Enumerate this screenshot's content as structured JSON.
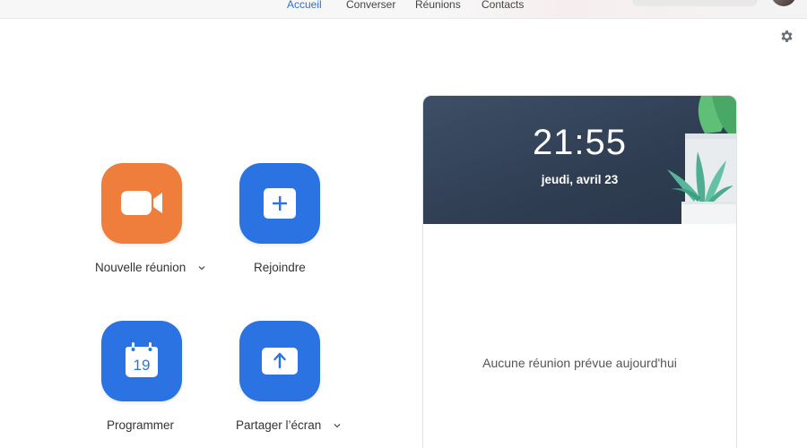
{
  "nav": {
    "tabs": [
      {
        "label": "Accueil",
        "active": true
      },
      {
        "label": "Converser",
        "active": false
      },
      {
        "label": "Réunions",
        "active": false
      },
      {
        "label": "Contacts",
        "active": false
      }
    ]
  },
  "actions": {
    "new_meeting": {
      "label": "Nouvelle réunion",
      "icon": "video-camera-icon",
      "color": "#ef7d3b"
    },
    "join": {
      "label": "Rejoindre",
      "icon": "plus-icon",
      "color": "#2b73e2"
    },
    "schedule": {
      "label": "Programmer",
      "icon": "calendar-icon",
      "calendar_day": "19",
      "color": "#2b73e2"
    },
    "share_screen": {
      "label": "Partager l’écran",
      "icon": "upload-arrow-icon",
      "color": "#2b73e2"
    }
  },
  "meetings_panel": {
    "time": "21:55",
    "date": "jeudi, avril 23",
    "empty_message": "Aucune réunion prévue aujourd'hui"
  },
  "colors": {
    "accent": "#2d6fd6",
    "banner": "#34445a"
  }
}
